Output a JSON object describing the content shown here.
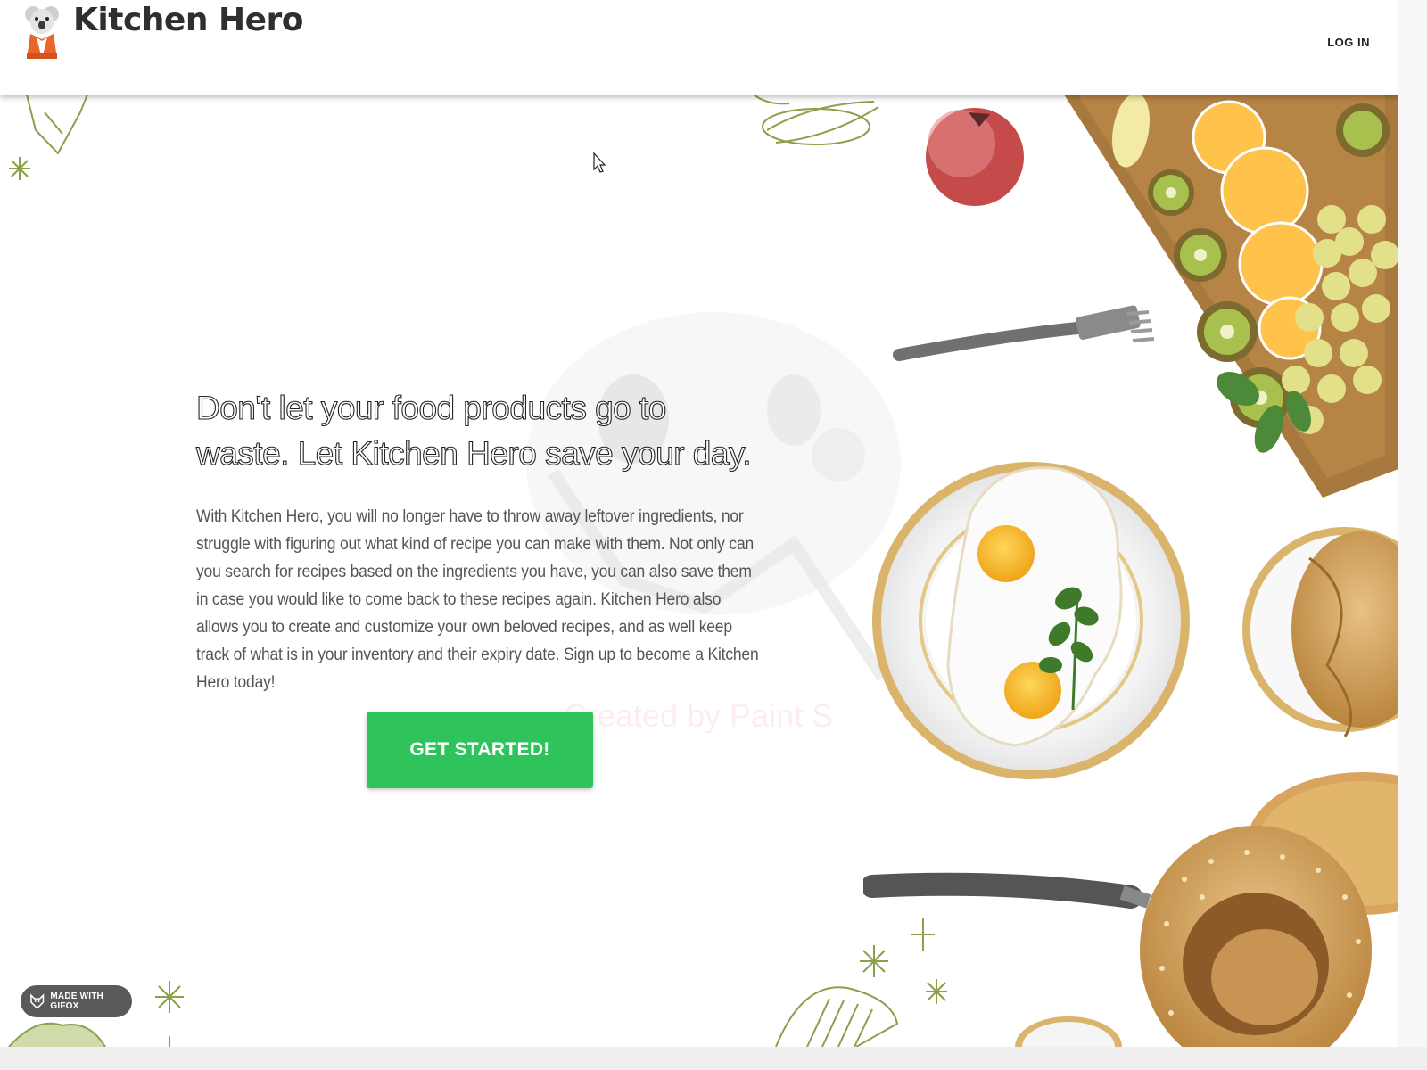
{
  "app": {
    "name": "Kitchen Hero",
    "logo_icon": "koala-chef-logo"
  },
  "header": {
    "login_label": "LOG IN"
  },
  "hero": {
    "title": "Don't let your food products go to waste. Let Kitchen Hero save your day.",
    "body": "With Kitchen Hero, you will no longer have to throw away leftover ingredients, nor struggle with figuring out what kind of recipe you can make with them. Not only can you search for recipes based on the ingredients you have, you can also save them in case you would like to come back to these recipes again. Kitchen Hero also allows you to create and customize your own beloved recipes, and as well keep track of what is in your inventory and their expiry date. Sign up to become a Kitchen Hero today!",
    "cta_label": "GET STARTED!"
  },
  "overlays": {
    "watermark": "Created by Paint S",
    "badge": "MADE WITH GIFOX"
  },
  "colors": {
    "accent": "#2ec35b",
    "brand_text": "#2f2f2f",
    "body_text": "#555555",
    "doodle": "#8aa04a"
  }
}
